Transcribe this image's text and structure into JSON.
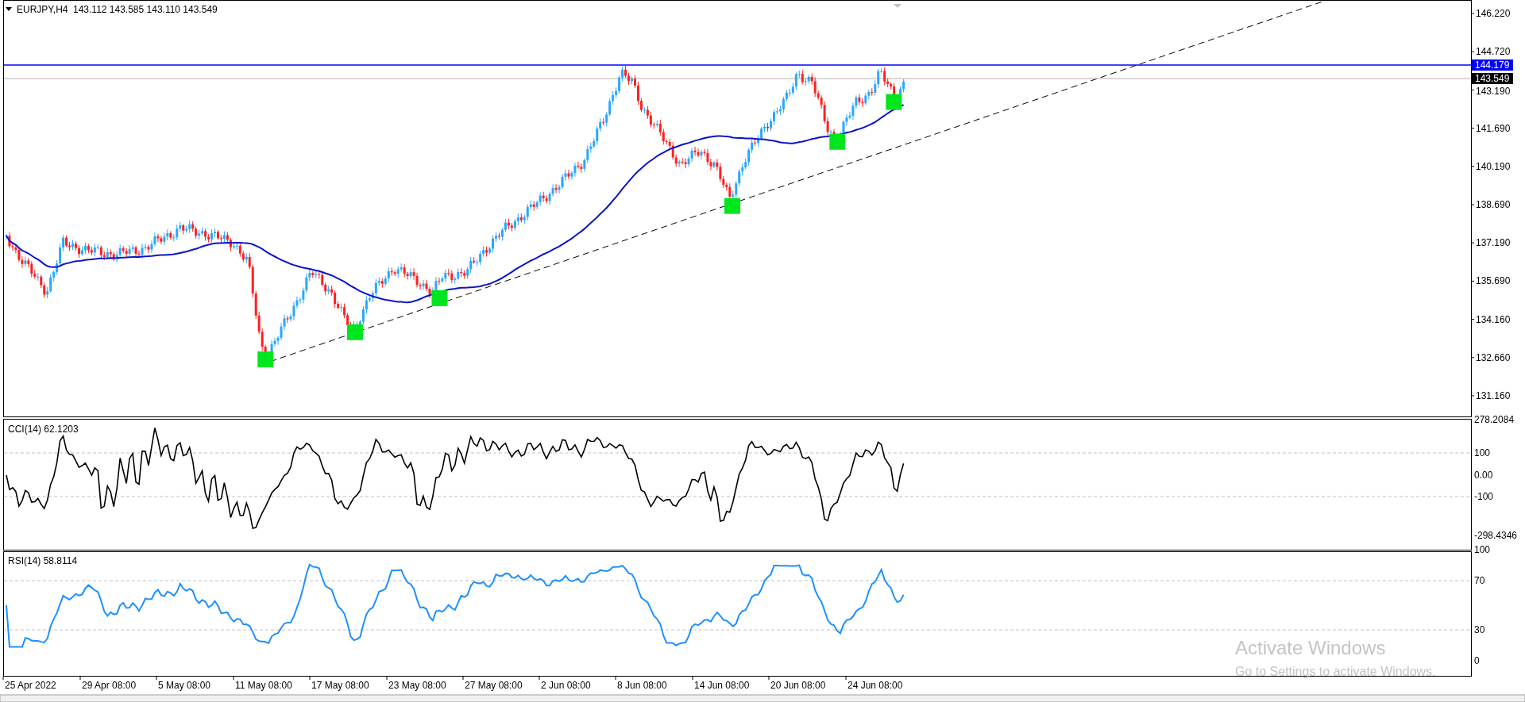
{
  "chart": {
    "symbol": "EURJPY,H4",
    "quote": "143.112 143.585 143.110 143.549",
    "price_axis": [
      "146.220",
      "144.720",
      "143.190",
      "141.690",
      "140.190",
      "138.690",
      "137.190",
      "135.690",
      "134.160",
      "132.660",
      "131.160"
    ],
    "price_tags": [
      {
        "text": "144.179",
        "kind": "line"
      },
      {
        "text": "143.549",
        "kind": "bid"
      }
    ]
  },
  "cci_panel": {
    "label": "CCI(14) 62.1203",
    "axis": [
      "278.2084",
      "100",
      "0.00",
      "-100",
      "-298.4346"
    ]
  },
  "rsi_panel": {
    "label": "RSI(14) 58.8114",
    "axis": [
      "100",
      "70",
      "30",
      "0"
    ]
  },
  "time_axis": [
    "25 Apr 2022",
    "29 Apr 08:00",
    "5 May 08:00",
    "11 May 08:00",
    "17 May 08:00",
    "23 May 08:00",
    "27 May 08:00",
    "2 Jun 08:00",
    "8 Jun 08:00",
    "14 Jun 08:00",
    "20 Jun 08:00",
    "24 Jun 08:00"
  ],
  "watermark": {
    "title": "Activate Windows",
    "subtitle": "Go to Settings to activate Windows."
  }
}
